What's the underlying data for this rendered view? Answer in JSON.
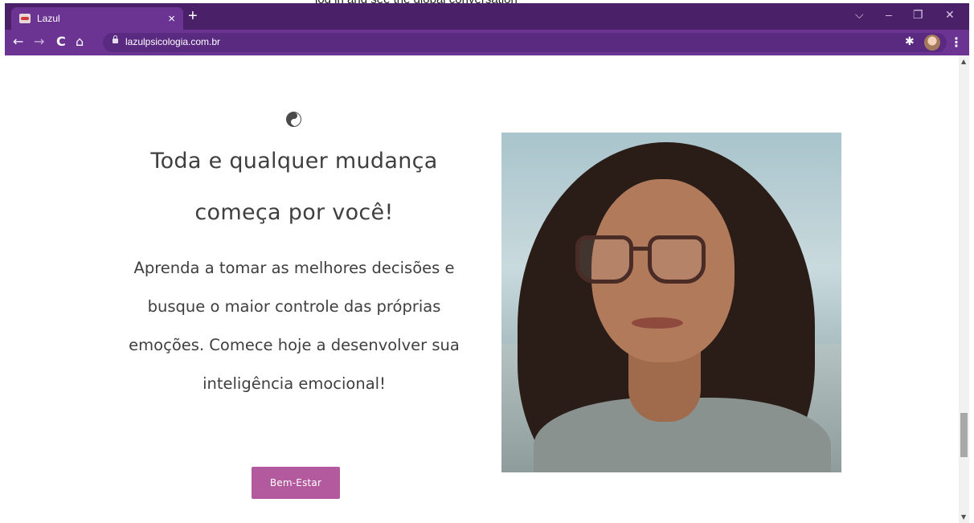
{
  "page_top_text": "log in and see the global conversation",
  "browser": {
    "tab_title": "Lazul",
    "tab_close": "×",
    "new_tab": "+",
    "window_controls": {
      "tab_search": "⌵",
      "minimize": "–",
      "restore": "❐",
      "close": "✕"
    },
    "nav": {
      "back": "←",
      "forward": "→",
      "reload": "C",
      "home": "⌂"
    },
    "url": "lazulpsicologia.com.br",
    "bookmark": "☆",
    "menu": "⋮"
  },
  "content": {
    "headline": "Toda e qualquer mudança começa por você!",
    "body": "Aprenda a tomar as melhores decisões e busque o maior controle das próprias emoções. Comece hoje a desenvolver sua inteligência emocional!",
    "button_label": "Bem-Estar"
  },
  "colors": {
    "browser_frame": "#4a2068",
    "toolbar": "#6b3493",
    "text": "#3f3f3f",
    "button": "#b35a9e"
  }
}
